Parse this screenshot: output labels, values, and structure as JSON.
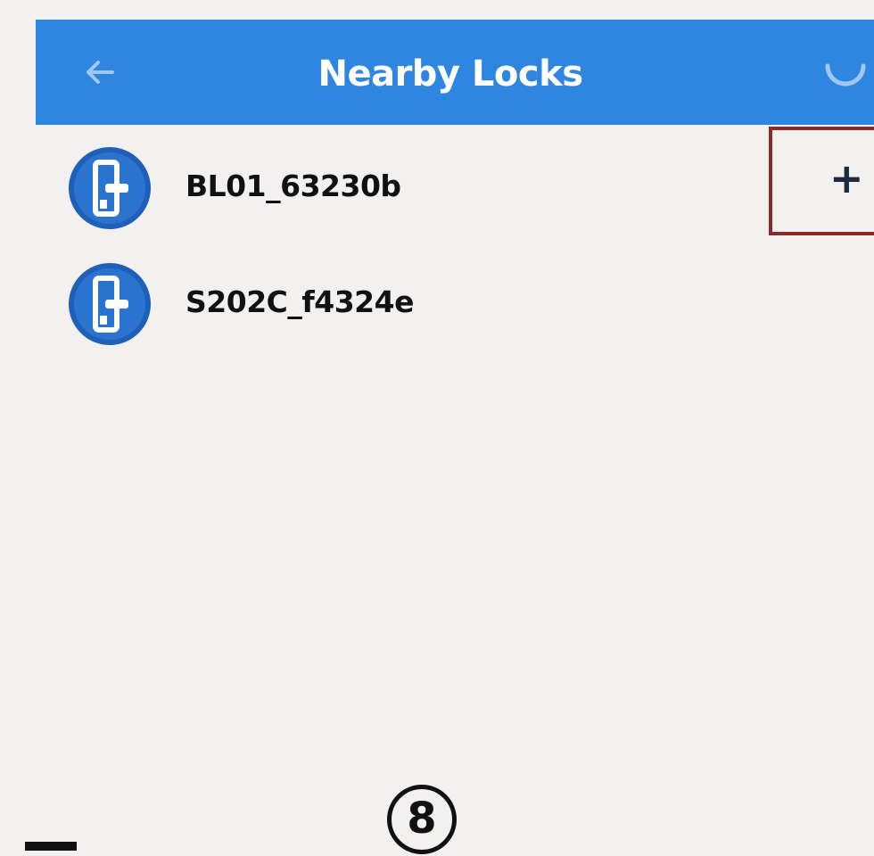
{
  "header": {
    "title": "Nearby Locks",
    "back_icon": "arrow-left-icon",
    "refresh_icon": "refresh-icon",
    "background_color": "#2f86e0"
  },
  "locks": [
    {
      "name": "BL01_63230b",
      "icon": "lock-device-icon"
    },
    {
      "name": "S202C_f4324e",
      "icon": "lock-device-icon"
    }
  ],
  "add_button": {
    "label": "+",
    "highlight_color": "#8a2a2a"
  },
  "step_marker": {
    "label": "8"
  }
}
